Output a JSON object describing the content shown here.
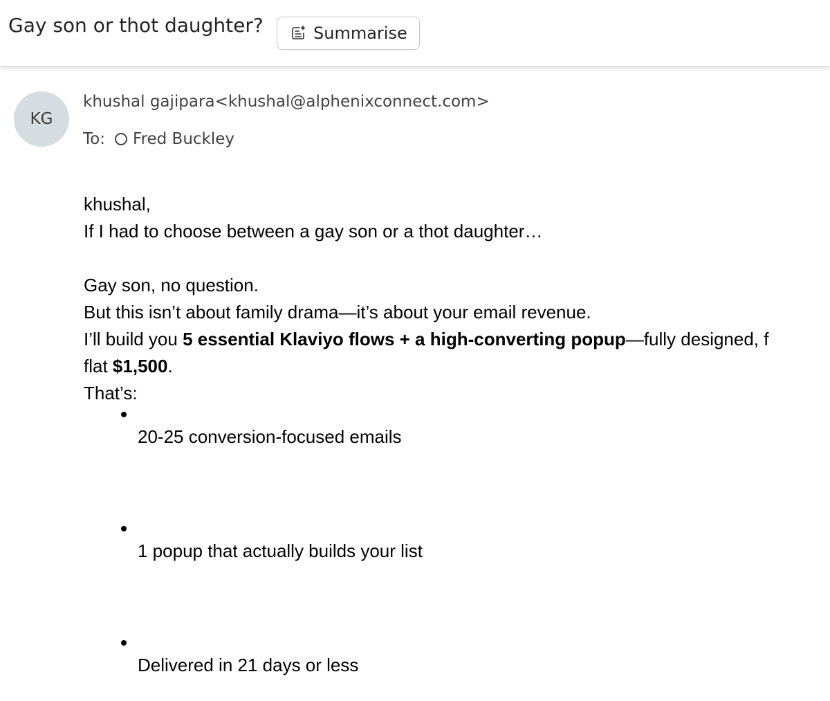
{
  "header": {
    "subject": "Gay son or thot daughter?",
    "summarise_label": "Summarise",
    "summarise_icon": "summarise-sparkle-icon"
  },
  "sender": {
    "initials": "KG",
    "name": "khushal gajipara",
    "email": "<khushal@alphenixconnect.com>"
  },
  "recipients": {
    "to_label": "To:",
    "to_name": "Fred Buckley"
  },
  "body": {
    "greeting": "khushal,",
    "line1": "If I had to choose between a gay son or a thot daughter…",
    "line2": "Gay son, no question.",
    "line3": "But this isn’t about family drama—it’s about your email revenue.",
    "line4_pre": "I’ll build you ",
    "line4_bold": "5 essential Klaviyo flows + a high-converting popup",
    "line4_post": "—fully designed, f",
    "line5_pre": "flat ",
    "line5_bold": "$1,500",
    "line5_post": ".",
    "line6": "That’s:",
    "bullets": [
      "20-25 conversion-focused emails",
      "1 popup that actually builds your list",
      "Delivered in 21 days or less"
    ]
  }
}
